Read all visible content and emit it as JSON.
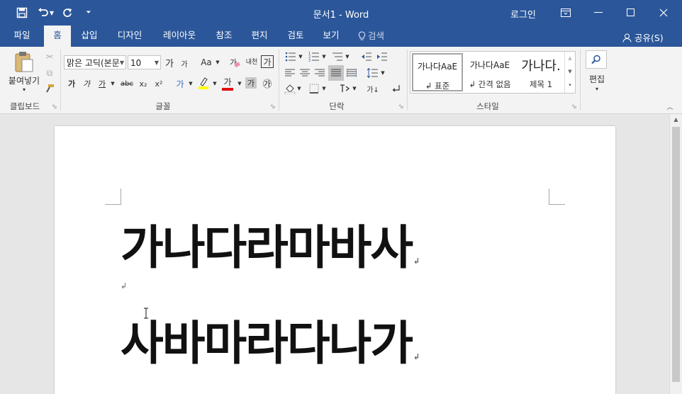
{
  "titlebar": {
    "title": "문서1  -  Word",
    "login_label": "로그인",
    "save_icon": "save-icon",
    "undo_icon": "undo-icon",
    "redo_icon": "redo-icon",
    "customize_icon": "customize-qat-icon",
    "accent_color": "#2b579a"
  },
  "tabs": [
    {
      "label": "파일"
    },
    {
      "label": "홈",
      "active": true
    },
    {
      "label": "삽입"
    },
    {
      "label": "디자인"
    },
    {
      "label": "레이아웃"
    },
    {
      "label": "참조"
    },
    {
      "label": "편지"
    },
    {
      "label": "검토"
    },
    {
      "label": "보기"
    },
    {
      "label": "검색"
    }
  ],
  "share_label": "공유(S)",
  "ribbon": {
    "clipboard": {
      "paste_label": "붙여넣기",
      "group_label": "클립보드"
    },
    "font": {
      "font_name": "맑은 고딕(본문",
      "font_size": "10",
      "change_case": "Aa",
      "phonetic_label": "내천",
      "enclose_char": "가",
      "group_label": "글꼴",
      "buttons": {
        "bold": "가",
        "italic": "가",
        "underline": "가",
        "strike": "abc",
        "subscript": "x₂",
        "superscript": "x²",
        "grow": "가",
        "shrink": "가",
        "text_effect": "가",
        "font_color": "가",
        "shading": "가",
        "enclosed": "㉮"
      }
    },
    "paragraph": {
      "group_label": "단락",
      "hangul_align": "가↓"
    },
    "styles": {
      "group_label": "스타일",
      "items": [
        {
          "sample": "가나다AaE",
          "name": "↲ 표준"
        },
        {
          "sample": "가나다AaE",
          "name": "↲ 간격 없음"
        },
        {
          "sample": "가나다.",
          "name": "제목 1"
        }
      ]
    },
    "editing": {
      "label": "편집"
    }
  },
  "document": {
    "line1": "가나다라마바사",
    "line2": "사바마라다나가",
    "para_mark": "↲"
  }
}
